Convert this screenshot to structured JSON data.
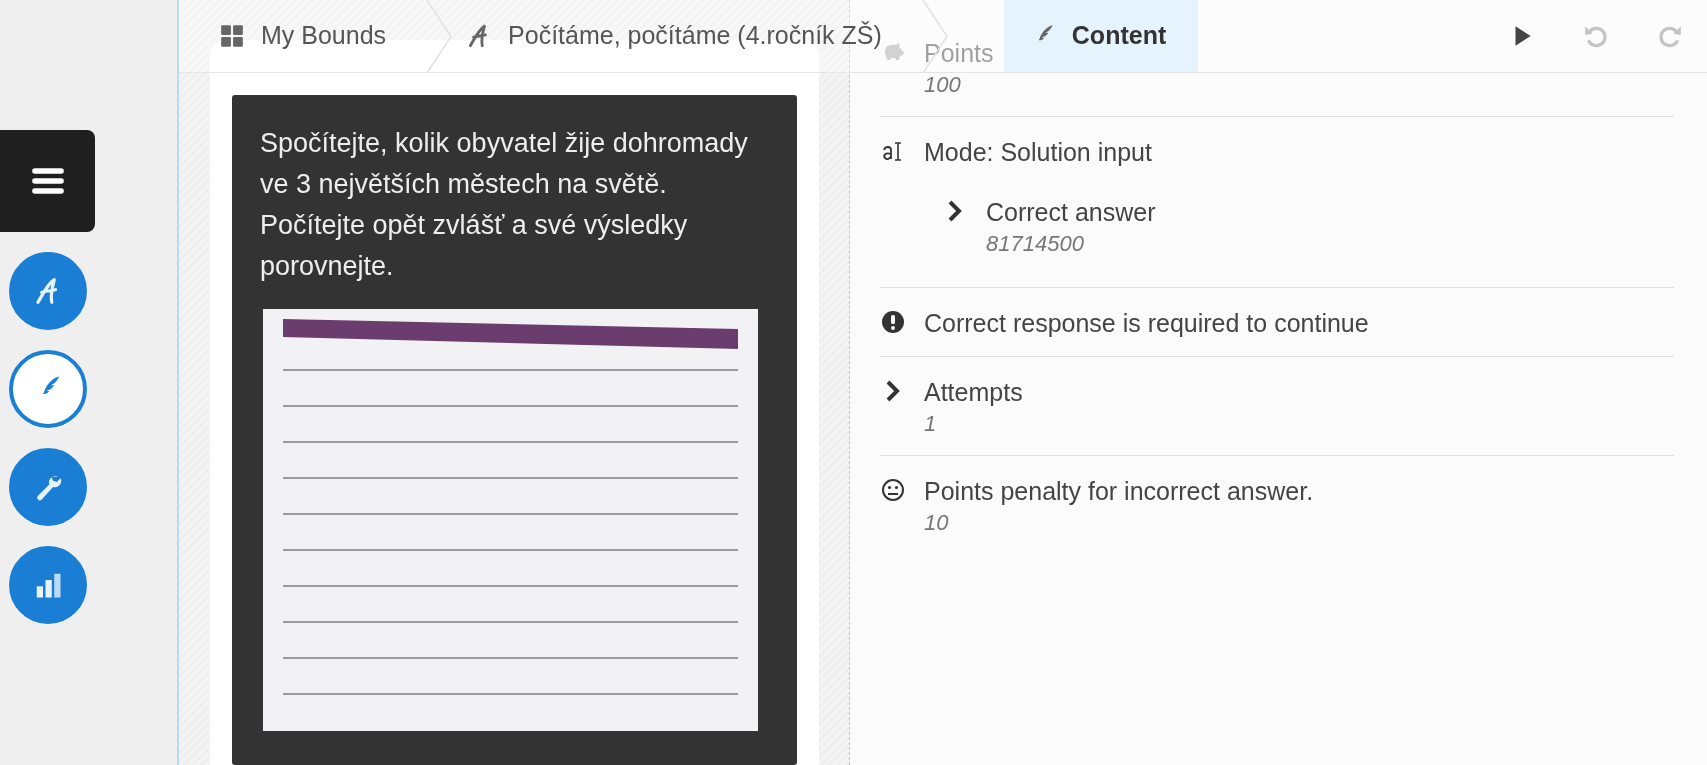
{
  "sidebar": {
    "menu_button": true,
    "items": [
      {
        "kind": "script",
        "selected": false
      },
      {
        "kind": "feather",
        "selected": true
      },
      {
        "kind": "wrench",
        "selected": false
      },
      {
        "kind": "chart",
        "selected": false
      }
    ]
  },
  "breadcrumb": [
    {
      "kind": "grid",
      "label": "My Bounds",
      "selected": false
    },
    {
      "kind": "script",
      "label": "Počítáme, počítáme (4.ročník ZŠ)",
      "selected": false
    },
    {
      "kind": "feather",
      "label": "Content",
      "selected": true
    }
  ],
  "toolbar": [
    {
      "kind": "play",
      "disabled": false
    },
    {
      "kind": "undo",
      "disabled": true
    },
    {
      "kind": "redo",
      "disabled": true
    }
  ],
  "question": {
    "text": "Spočítejte, kolik obyvatel žije dohromady ve 3 největších městech na světě. Počítejte opět zvlášť a své výsledky porovnejte."
  },
  "settings": [
    {
      "kind": "points",
      "label": "Points",
      "value": "100"
    },
    {
      "kind": "mode",
      "label": "Mode: Solution input",
      "children": [
        {
          "kind": "collapsible",
          "label": "Correct answer",
          "value": "81714500"
        }
      ]
    },
    {
      "kind": "required",
      "label": "Correct response is required to continue"
    },
    {
      "kind": "collapsible",
      "label": "Attempts",
      "value": "1"
    },
    {
      "kind": "penalty",
      "label": "Points penalty for incorrect answer.",
      "value": "10"
    }
  ]
}
